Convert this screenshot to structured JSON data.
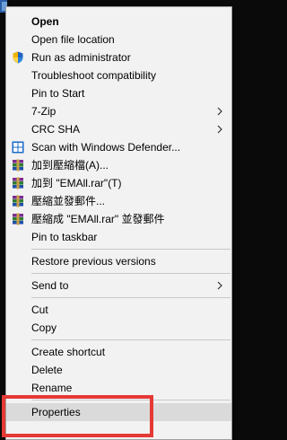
{
  "menu": {
    "items": [
      {
        "label": "Open",
        "bold": true
      },
      {
        "label": "Open file location"
      },
      {
        "label": "Run as administrator",
        "icon": "uac-shield-icon"
      },
      {
        "label": "Troubleshoot compatibility"
      },
      {
        "label": "Pin to Start"
      },
      {
        "label": "7-Zip",
        "submenu": true
      },
      {
        "label": "CRC SHA",
        "submenu": true
      },
      {
        "label": "Scan with Windows Defender...",
        "icon": "windows-defender-icon"
      },
      {
        "label": "加到壓縮檔(A)...",
        "icon": "winrar-icon"
      },
      {
        "label": "加到 \"EMAll.rar\"(T)",
        "icon": "winrar-icon"
      },
      {
        "label": "壓縮並發郵件...",
        "icon": "winrar-icon"
      },
      {
        "label": "壓縮成 \"EMAll.rar\" 並發郵件",
        "icon": "winrar-icon"
      },
      {
        "label": "Pin to taskbar"
      },
      {
        "label": "Restore previous versions"
      },
      {
        "label": "Send to",
        "submenu": true
      },
      {
        "label": "Cut"
      },
      {
        "label": "Copy"
      },
      {
        "label": "Create shortcut"
      },
      {
        "label": "Delete"
      },
      {
        "label": "Rename"
      },
      {
        "label": "Properties",
        "highlight": true
      }
    ]
  },
  "colors": {
    "menu_bg": "#f2f2f2",
    "highlight": "#dadada",
    "separator": "#c8c8c8",
    "annotation_box": "#e53935"
  }
}
